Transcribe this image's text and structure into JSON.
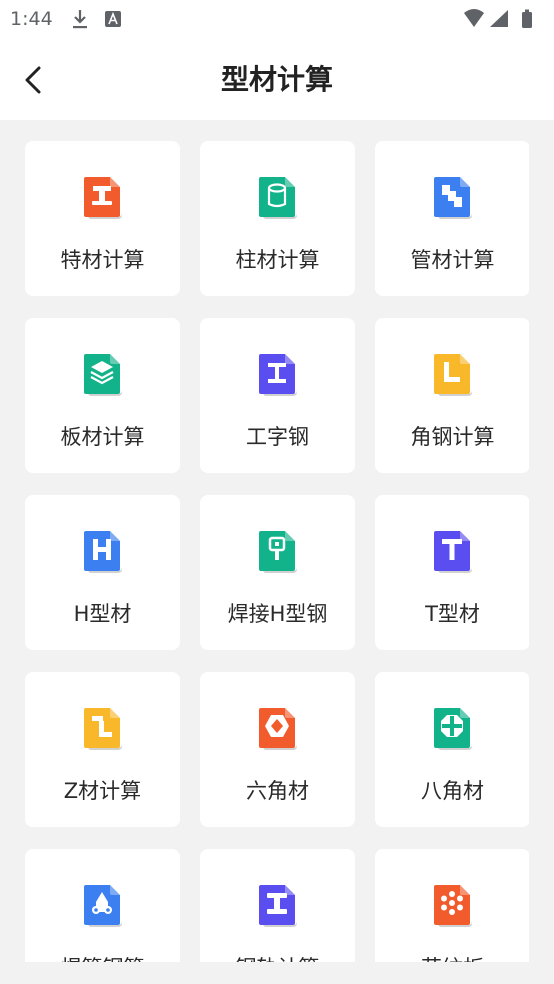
{
  "status_bar": {
    "time": "1:44"
  },
  "header": {
    "title": "型材计算",
    "back_icon": "back-arrow-icon"
  },
  "items": [
    {
      "label": "特材计算",
      "color": "#f25b2c",
      "icon": "special-material-icon",
      "glyph": "stool"
    },
    {
      "label": "柱材计算",
      "color": "#12b38a",
      "icon": "column-icon",
      "glyph": "cylinder"
    },
    {
      "label": "管材计算",
      "color": "#3b7ff0",
      "icon": "pipe-icon",
      "glyph": "steps"
    },
    {
      "label": "板材计算",
      "color": "#12b38a",
      "icon": "plate-icon",
      "glyph": "layers"
    },
    {
      "label": "工字钢",
      "color": "#5b4ef0",
      "icon": "i-beam-icon",
      "glyph": "I"
    },
    {
      "label": "角钢计算",
      "color": "#f9b72a",
      "icon": "angle-steel-icon",
      "glyph": "L"
    },
    {
      "label": "H型材",
      "color": "#3b7ff0",
      "icon": "h-profile-icon",
      "glyph": "H"
    },
    {
      "label": "焊接H型钢",
      "color": "#12b38a",
      "icon": "welded-h-icon",
      "glyph": "pin"
    },
    {
      "label": "T型材",
      "color": "#5b4ef0",
      "icon": "t-profile-icon",
      "glyph": "T"
    },
    {
      "label": "Z材计算",
      "color": "#f9b72a",
      "icon": "z-profile-icon",
      "glyph": "Z"
    },
    {
      "label": "六角材",
      "color": "#f25b2c",
      "icon": "hexagon-icon",
      "glyph": "hex"
    },
    {
      "label": "八角材",
      "color": "#12b38a",
      "icon": "octagon-icon",
      "glyph": "oct"
    },
    {
      "label": "焊管钢管",
      "color": "#3b7ff0",
      "icon": "welded-pipe-icon",
      "glyph": "pipes"
    },
    {
      "label": "钢轨计算",
      "color": "#5b4ef0",
      "icon": "rail-icon",
      "glyph": "rail"
    },
    {
      "label": "花纹板",
      "color": "#f25b2c",
      "icon": "pattern-plate-icon",
      "glyph": "flower"
    }
  ]
}
